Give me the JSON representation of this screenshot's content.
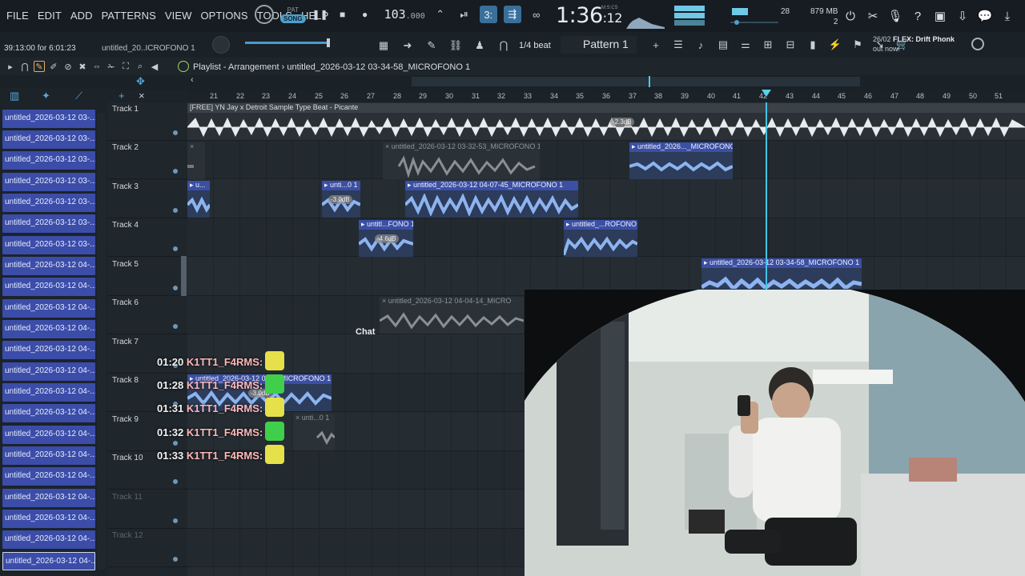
{
  "menu": [
    "FILE",
    "EDIT",
    "ADD",
    "PATTERNS",
    "VIEW",
    "OPTIONS",
    "TOOLS",
    "HELP"
  ],
  "transport": {
    "mode_top": "PAT",
    "mode_song": "SONG",
    "tempo": "103",
    "tempo_decimal": ".000"
  },
  "clock": {
    "main": "1:36",
    "sub": ":12",
    "unit": "M:S:CS"
  },
  "status": {
    "poly": "28",
    "mem_value": "879 MB",
    "mem_sub": "2"
  },
  "hint": {
    "time": "39:13:00 for 6:01:23",
    "project": "untitled_20..ICROFONO 1"
  },
  "snap": "1/4 beat",
  "pattern": "Pattern 1",
  "news": {
    "date": "26/02",
    "title": "FLEX: Drift Phonk",
    "sub": "out now!"
  },
  "playlist": {
    "title": "Playlist - Arrangement",
    "sep": "›",
    "clip": "untitled_2026-03-12 03-34-58_MICROFONO 1"
  },
  "ruler": [
    "21",
    "22",
    "23",
    "24",
    "25",
    "26",
    "27",
    "28",
    "29",
    "30",
    "31",
    "32",
    "33",
    "34",
    "35",
    "36",
    "37",
    "38",
    "39",
    "40",
    "41",
    "42",
    "43",
    "44",
    "45",
    "46",
    "47",
    "48",
    "49",
    "50",
    "51"
  ],
  "browser_items": [
    "untitled_2026-03-12 03-...",
    "untitled_2026-03-12 03-...",
    "untitled_2026-03-12 03-...",
    "untitled_2026-03-12 03-...",
    "untitled_2026-03-12 03-...",
    "untitled_2026-03-12 03-...",
    "untitled_2026-03-12 03-...",
    "untitled_2026-03-12 04-...",
    "untitled_2026-03-12 04-...",
    "untitled_2026-03-12 04-...",
    "untitled_2026-03-12 04-...",
    "untitled_2026-03-12 04-...",
    "untitled_2026-03-12 04-...",
    "untitled_2026-03-12 04-...",
    "untitled_2026-03-12 04-...",
    "untitled_2026-03-12 04-...",
    "untitled_2026-03-12 04-...",
    "untitled_2026-03-12 04-...",
    "untitled_2026-03-12 04-...",
    "untitled_2026-03-12 04-...",
    "untitled_2026-03-12 04-...",
    "untitled_2026-03-12 04-..."
  ],
  "tracks": [
    "Track 1",
    "Track 2",
    "Track 3",
    "Track 4",
    "Track 5",
    "Track 6",
    "Track 7",
    "Track 8",
    "Track 9",
    "Track 10",
    "Track 11",
    "Track 12"
  ],
  "clips": {
    "t1": "[FREE] YN Jay x Detroit Sample Type Beat - Picante",
    "t1_gain": "-2.3dB",
    "t2a": "×",
    "t2b": "× untitled_2026-03-12 03-32-53_MICROFONO 1",
    "t2c": "▸ untitled_2026..._MICROFONO 1",
    "t3a": "▸ u...",
    "t3b": "▸ unti...0 1",
    "t3b_gain": "-3.0dB",
    "t3c": "▸ untitled_2026-03-12 04-07-45_MICROFONO 1",
    "t4a": "▸ untitl...FONO 1",
    "t4a_gain": "-4.6dB",
    "t4b": "▸ untitled_...ROFONO 1",
    "t5": "▸ untitled_2026-03-12 03-34-58_MICROFONO 1",
    "t6": "× untitled_2026-03-12 04-04-14_MICRO",
    "t8": "▸ untitled_2026-03-12 04-... MICROFONO 1",
    "t8_gain": "-3.0dB",
    "t9": "× unti...0 1"
  },
  "chat": {
    "label": "Chat",
    "lines": [
      {
        "time": "01:20",
        "user": "K1TT1_F4RMS:"
      },
      {
        "time": "01:28",
        "user": "K1TT1_F4RMS:"
      },
      {
        "time": "01:31",
        "user": "K1TT1_F4RMS:"
      },
      {
        "time": "01:32",
        "user": "K1TT1_F4RMS:"
      },
      {
        "time": "01:33",
        "user": "K1TT1_F4RMS:"
      }
    ]
  },
  "colors": {
    "clip_header": "#3b4fa4",
    "playhead": "#42c4e4",
    "browser_item": "#3b4da8"
  }
}
